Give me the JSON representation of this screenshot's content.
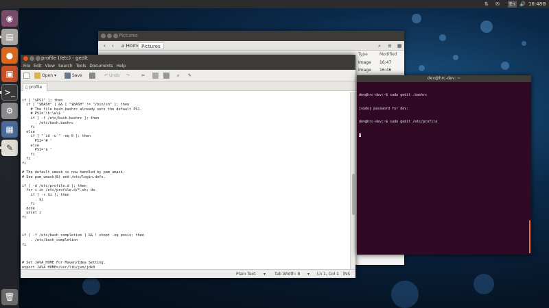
{
  "top_panel": {
    "indicators": {
      "input_method": "En",
      "time": "16:48"
    }
  },
  "launcher": {
    "items": [
      {
        "name": "dash",
        "icon": "ubuntu-logo-icon"
      },
      {
        "name": "files",
        "icon": "files-icon"
      },
      {
        "name": "firefox",
        "icon": "firefox-icon"
      },
      {
        "name": "software-center",
        "icon": "software-center-icon"
      },
      {
        "name": "terminal",
        "icon": "terminal-icon"
      },
      {
        "name": "settings",
        "icon": "settings-icon"
      },
      {
        "name": "workspaces",
        "icon": "workspaces-icon"
      },
      {
        "name": "gedit",
        "icon": "text-editor-icon"
      },
      {
        "name": "trash",
        "icon": "trash-icon"
      }
    ]
  },
  "nautilus": {
    "title": "Pictures",
    "breadcrumbs": [
      "Home",
      "Pictures"
    ],
    "columns": [
      "Type",
      "Modified"
    ],
    "rows": [
      {
        "type": "Image",
        "modified": "16:47"
      },
      {
        "type": "Image",
        "modified": "16:46"
      }
    ]
  },
  "gedit": {
    "title": "profile (/etc) - gedit",
    "menu": [
      "File",
      "Edit",
      "View",
      "Search",
      "Tools",
      "Documents",
      "Help"
    ],
    "toolbar": {
      "open_label": "Open",
      "save_label": "Save",
      "undo_label": "Undo"
    },
    "tab_label": "profile",
    "content": "\nif [ \"$PS1\" ]; then\n  if [ \"$BASH\" ] && [ \"$BASH\" != \"/bin/sh\" ]; then\n    # The file bash.bashrc already sets the default PS1.\n    # PS1='\\h:\\w\\$ '\n    if [ -f /etc/bash.bashrc ]; then\n      . /etc/bash.bashrc\n    fi\n  else\n    if [ \"`id -u`\" -eq 0 ]; then\n      PS1='# '\n    else\n      PS1='$ '\n    fi\n  fi\nfi\n\n# The default umask is now handled by pam_umask.\n# See pam_umask(8) and /etc/login.defs.\n\nif [ -d /etc/profile.d ]; then\n  for i in /etc/profile.d/*.sh; do\n    if [ -r $i ]; then\n      . $i\n    fi\n  done\n  unset i\nfi\n\n\n\nif [ -f /etc/bash_completion ] && ! shopt -oq posix; then\n    . /etc/bash_completion\nfi\n\n\n\n# Set JAVA_HOME For Maven/Idea Setting.\nexport JAVA_HOME=/usr/lib/jvm/jdk8\nexport JDK_HOME=$JAVA_HOME\nexport IDEA_JDK=$JAVA_HOME\nexport PATH=$PATH:$JAVA_HOME/bin",
    "status": {
      "language": "Plain Text",
      "tab_width": "Tab Width: 8",
      "position": "Ln 1, Col 1",
      "mode": "INS"
    }
  },
  "terminal": {
    "title": "dev@hrc-dev: ~",
    "lines": [
      "dev@hrc-dev:~$ sudo gedit .bashrc",
      "[sudo] password for dev:",
      "dev@hrc-dev:~$ sudo gedit /etc/profile"
    ]
  }
}
